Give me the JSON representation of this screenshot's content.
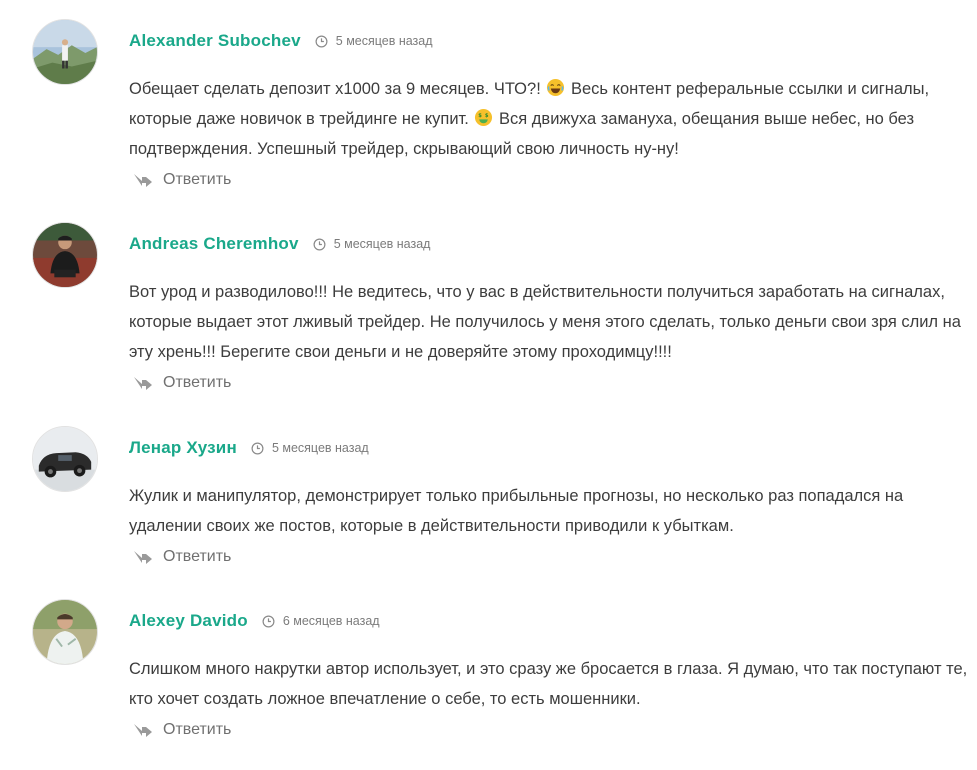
{
  "comments": [
    {
      "author": "Alexander Subochev",
      "date": "5 месяцев назад",
      "text_before_emoji1": "Обещает сделать депозит х1000 за 9 месяцев. ЧТО?! ",
      "text_mid": " Весь контент реферальные ссылки и сигналы, которые даже новичок в трейдинге не купит. ",
      "text_after": " Вся движуха замануха, обещания выше небес, но без подтверждения. Успешный трейдер, скрывающий свою личность ну-ну!",
      "emoji1": "laughing-emoji",
      "emoji2": "money-mouth-emoji",
      "reply_label": "Ответить"
    },
    {
      "author": "Andreas Cheremhov",
      "date": "5 месяцев назад",
      "text": "Вот урод и разводилово!!! Не ведитесь, что у вас в действительности получиться заработать на сигналах, которые выдает этот лживый трейдер. Не получилось у меня этого сделать, только деньги свои зря слил на эту хрень!!! Берегите свои деньги и не доверяйте этому проходимцу!!!!",
      "reply_label": "Ответить"
    },
    {
      "author": "Ленар Хузин",
      "date": "5 месяцев назад",
      "text": "Жулик и манипулятор, демонстрирует только прибыльные прогнозы, но несколько раз попадался на удалении своих же постов, которые в действительности приводили к убыткам.",
      "reply_label": "Ответить"
    },
    {
      "author": "Alexey Davido",
      "date": "6 месяцев назад",
      "text": "Слишком много накрутки автор использует, и это сразу же бросается в глаза. Я думаю, что так поступают те, кто хочет создать ложное впечатление о себе, то есть мошенники.",
      "reply_label": "Ответить"
    }
  ],
  "colors": {
    "author": "#1aa88a",
    "meta": "#7b7b7b",
    "text": "#3d3d3d",
    "reply": "#707070"
  },
  "icons": {
    "date": "clock-icon",
    "reply": "reply-arrow-icon"
  }
}
